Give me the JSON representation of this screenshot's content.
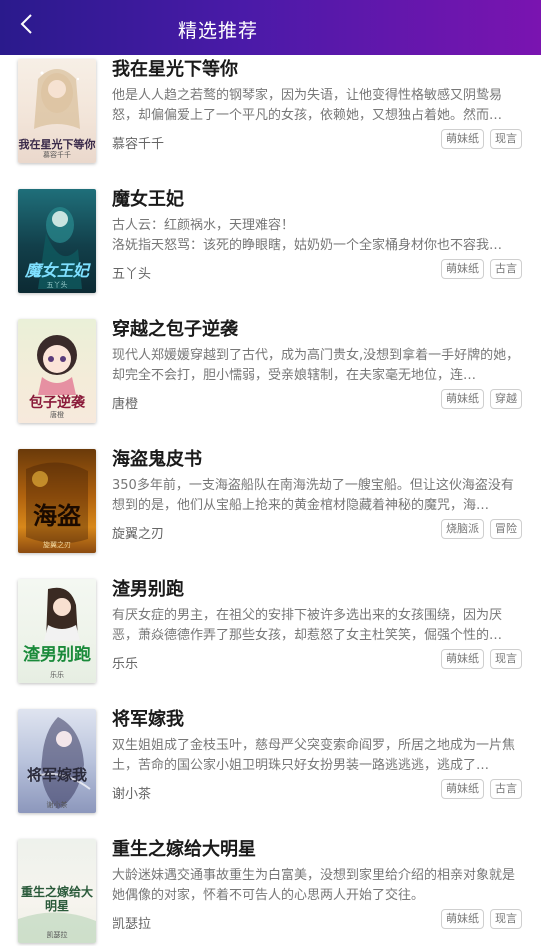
{
  "header": {
    "title": "精选推荐",
    "back_icon": "chevron-left-icon"
  },
  "colors": {
    "header_start": "#2a1a8c",
    "header_end": "#7a14b0"
  },
  "books": [
    {
      "title": "我在星光下等你",
      "desc": "他是人人趋之若鹜的钢琴家，因为失语，让他变得性格敏感又阴鸷易怒，却偏偏爱上了一个平凡的女孩，依赖她，又想独占着她。然而…",
      "author": "慕容千千",
      "tags": [
        "萌妹纸",
        "现言"
      ],
      "cover_text": "我在星光下等你",
      "cover_author": "慕容千千"
    },
    {
      "title": "魔女王妃",
      "desc": "古人云：红颜祸水，天理难容！\n洛妩指天怒骂：该死的睁眼瞎，姑奶奶一个全家桶身材你也不容我…",
      "author": "五丫头",
      "tags": [
        "萌妹纸",
        "古言"
      ],
      "cover_text": "魔女王妃",
      "cover_author": "五丫头"
    },
    {
      "title": "穿越之包子逆袭",
      "desc": "现代人郑媛媛穿越到了古代，成为高门贵女,没想到拿着一手好牌的她，却完全不会打，胆小懦弱，受亲娘辖制，在夫家毫无地位，连…",
      "author": "唐橙",
      "tags": [
        "萌妹纸",
        "穿越"
      ],
      "cover_text": "包子逆袭",
      "cover_author": "唐橙"
    },
    {
      "title": "海盗鬼皮书",
      "desc": "350多年前，一支海盗船队在南海洗劫了一艘宝船。但让这伙海盗没有想到的是，他们从宝船上抢来的黄金棺材隐藏着神秘的魔咒，海…",
      "author": "旋翼之刃",
      "tags": [
        "烧脑派",
        "冒险"
      ],
      "cover_text": "海盗",
      "cover_author": "旋翼之刃"
    },
    {
      "title": "渣男别跑",
      "desc": "有厌女症的男主，在祖父的安排下被许多选出来的女孩围绕，因为厌恶，萧焱德德作弄了那些女孩，却惹怒了女主杜笑笑，倔强个性的…",
      "author": "乐乐",
      "tags": [
        "萌妹纸",
        "现言"
      ],
      "cover_text": "渣男别跑",
      "cover_author": "乐乐"
    },
    {
      "title": "将军嫁我",
      "desc": "双生姐姐成了金枝玉叶，慈母严父突变索命阎罗，所居之地成为一片焦土，苦命的国公家小姐卫明珠只好女扮男装一路逃逃逃，逃成了…",
      "author": "谢小茶",
      "tags": [
        "萌妹纸",
        "古言"
      ],
      "cover_text": "将军嫁我",
      "cover_author": "谢小茶"
    },
    {
      "title": "重生之嫁给大明星",
      "desc": "大龄迷妹遇交通事故重生为白富美，没想到家里给介绍的相亲对象就是她偶像的对家，怀着不可告人的心思两人开始了交往。",
      "author": "凯瑟拉",
      "tags": [
        "萌妹纸",
        "现言"
      ],
      "cover_text": "重生之嫁给大明星",
      "cover_author": "凯瑟拉"
    }
  ]
}
